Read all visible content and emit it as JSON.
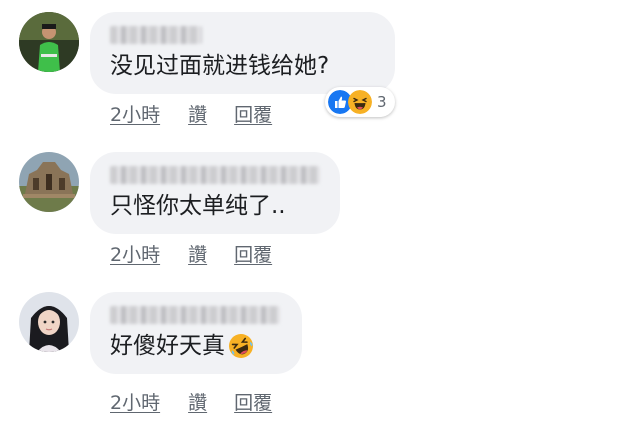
{
  "comments": [
    {
      "avatar": "user-avatar-man-green-shirt",
      "text": "没见过面就进钱给她?",
      "time": "2小時",
      "like_label": "讚",
      "reply_label": "回覆",
      "reactions": {
        "icons": [
          "like-reaction-icon",
          "haha-reaction-icon"
        ],
        "count": "3"
      }
    },
    {
      "avatar": "user-avatar-temple-ruins",
      "text": "只怪你太单纯了..",
      "time": "2小時",
      "like_label": "讚",
      "reply_label": "回覆"
    },
    {
      "avatar": "user-avatar-woman",
      "text": "好傻好天真",
      "emoji": "rofl-emoji-icon",
      "time": "2小時",
      "like_label": "讚",
      "reply_label": "回覆"
    }
  ],
  "colors": {
    "bubble": "#f1f2f5",
    "text": "#1c1e21",
    "meta": "#606770",
    "like_blue": "#1877f2",
    "haha_yellow": "#f7b125"
  }
}
